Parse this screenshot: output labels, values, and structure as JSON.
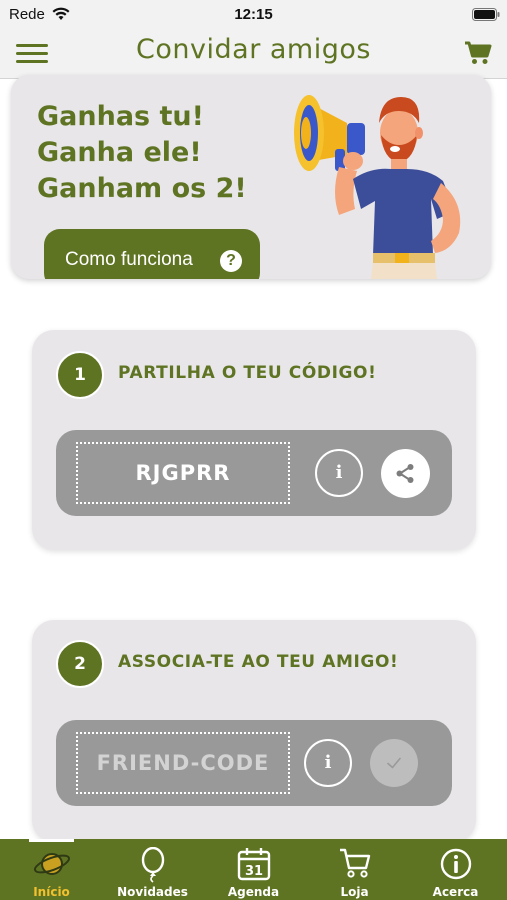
{
  "status_bar": {
    "carrier": "Rede",
    "time": "12:15"
  },
  "nav": {
    "title": "Convidar amigos",
    "menu_icon": "hamburger-menu-icon",
    "cart_icon": "shopping-cart-icon"
  },
  "banner": {
    "lines": [
      "Ganhas tu!",
      "Ganha ele!",
      "Ganham os 2!"
    ],
    "how_button_label": "Como funciona",
    "help_icon_glyph": "?",
    "illustration": "man-with-megaphone-illustration"
  },
  "step1": {
    "number": "1",
    "title": "PARTILHA O TEU CÓDIGO!",
    "code": "RJGPRR",
    "info_glyph": "i",
    "action_icon": "share-icon"
  },
  "step2": {
    "number": "2",
    "title": "ASSOCIA-TE AO TEU AMIGO!",
    "code_placeholder": "FRIEND-CODE",
    "info_glyph": "i",
    "action_icon": "checkmark-icon"
  },
  "tabs": [
    {
      "label": "Início",
      "icon": "planet-icon",
      "active": true
    },
    {
      "label": "Novidades",
      "icon": "balloon-icon",
      "active": false
    },
    {
      "label": "Agenda",
      "icon": "calendar-icon",
      "calendar_day": "31",
      "active": false
    },
    {
      "label": "Loja",
      "icon": "cart-icon",
      "active": false
    },
    {
      "label": "Acerca",
      "icon": "info-circle-icon",
      "active": false
    }
  ],
  "colors": {
    "brand_green": "#5e7423",
    "card_bg": "#e8e6e9",
    "panel_gray": "#999999",
    "active_tab": "#f2c12e"
  }
}
